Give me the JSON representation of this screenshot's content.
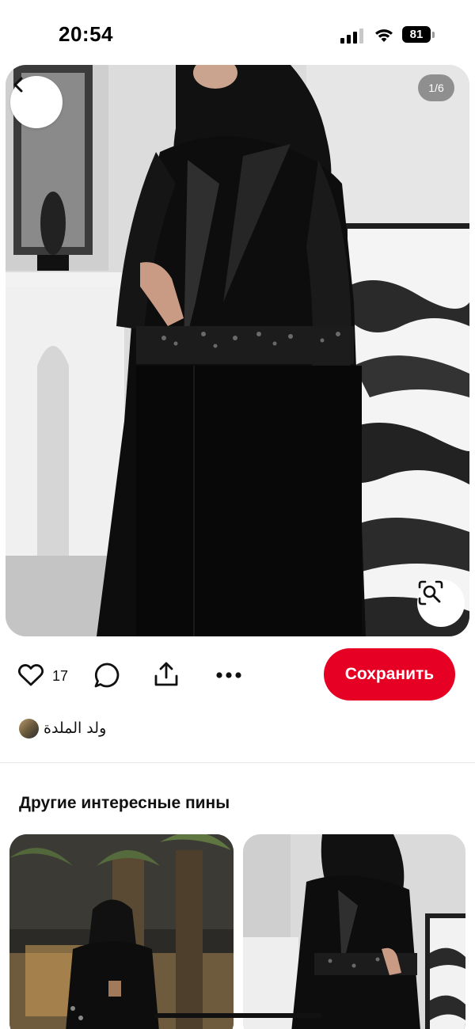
{
  "status_bar": {
    "time": "20:54",
    "battery": "81",
    "icons": [
      "signal-icon",
      "wifi-icon",
      "battery-icon"
    ]
  },
  "pin": {
    "page_counter": "1/6",
    "icons": [
      "back-arrow-icon",
      "visual-search-icon"
    ]
  },
  "actions": {
    "like_count": "17",
    "save_label": "Сохранить",
    "icons": [
      "heart-icon",
      "comment-icon",
      "share-icon",
      "more-icon"
    ]
  },
  "author": {
    "name": "ولد الملدة"
  },
  "related": {
    "title": "Другие интересные пины"
  },
  "colors": {
    "accent": "#e60023",
    "background": "#ffffff",
    "text": "#111111"
  }
}
